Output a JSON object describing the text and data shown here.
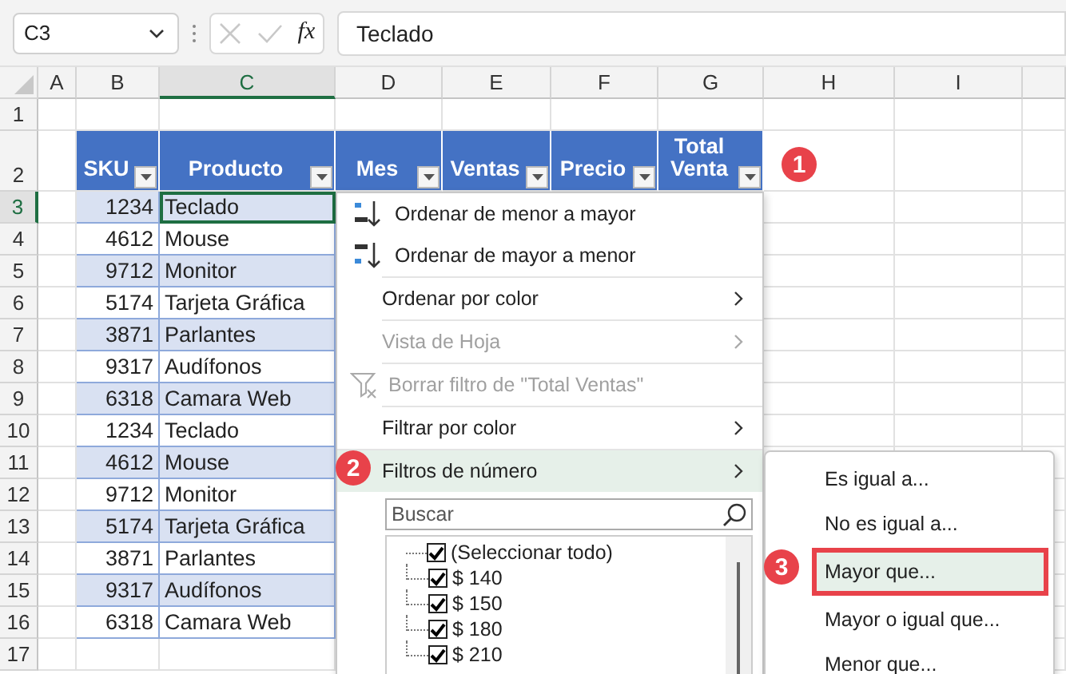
{
  "name_box": {
    "value": "C3"
  },
  "formula_bar": {
    "function_label": "fx",
    "value": "Teclado"
  },
  "columns": [
    {
      "label": "A",
      "selected": false
    },
    {
      "label": "B",
      "selected": false
    },
    {
      "label": "C",
      "selected": true
    },
    {
      "label": "D",
      "selected": false
    },
    {
      "label": "E",
      "selected": false
    },
    {
      "label": "F",
      "selected": false
    },
    {
      "label": "G",
      "selected": false
    },
    {
      "label": "H",
      "selected": false
    },
    {
      "label": "I",
      "selected": false
    }
  ],
  "rows": [
    {
      "label": "1",
      "selected": false
    },
    {
      "label": "2",
      "selected": false
    },
    {
      "label": "3",
      "selected": true
    },
    {
      "label": "4",
      "selected": false
    },
    {
      "label": "5",
      "selected": false
    },
    {
      "label": "6",
      "selected": false
    },
    {
      "label": "7",
      "selected": false
    },
    {
      "label": "8",
      "selected": false
    },
    {
      "label": "9",
      "selected": false
    },
    {
      "label": "10",
      "selected": false
    },
    {
      "label": "11",
      "selected": false
    },
    {
      "label": "12",
      "selected": false
    },
    {
      "label": "13",
      "selected": false
    },
    {
      "label": "14",
      "selected": false
    },
    {
      "label": "15",
      "selected": false
    },
    {
      "label": "16",
      "selected": false
    },
    {
      "label": "17",
      "selected": false
    }
  ],
  "table": {
    "headers": [
      {
        "label": "SKU"
      },
      {
        "label": "Producto"
      },
      {
        "label": "Mes"
      },
      {
        "label": "Ventas"
      },
      {
        "label": "Precio"
      },
      {
        "label": "Total Venta"
      }
    ],
    "rows": [
      {
        "cells": [
          "1234",
          "Teclado"
        ]
      },
      {
        "cells": [
          "4612",
          "Mouse"
        ]
      },
      {
        "cells": [
          "9712",
          "Monitor"
        ]
      },
      {
        "cells": [
          "5174",
          "Tarjeta Gráfica"
        ]
      },
      {
        "cells": [
          "3871",
          "Parlantes"
        ]
      },
      {
        "cells": [
          "9317",
          "Audífonos"
        ]
      },
      {
        "cells": [
          "6318",
          "Camara Web"
        ]
      },
      {
        "cells": [
          "1234",
          "Teclado"
        ]
      },
      {
        "cells": [
          "4612",
          "Mouse"
        ]
      },
      {
        "cells": [
          "9712",
          "Monitor"
        ]
      },
      {
        "cells": [
          "5174",
          "Tarjeta Gráfica"
        ]
      },
      {
        "cells": [
          "3871",
          "Parlantes"
        ]
      },
      {
        "cells": [
          "9317",
          "Audífonos"
        ]
      },
      {
        "cells": [
          "6318",
          "Camara Web"
        ]
      }
    ]
  },
  "filter_menu": {
    "items": [
      {
        "kind": "sort-asc",
        "label": "Ordenar de menor a mayor",
        "disabled": false,
        "selected": false
      },
      {
        "kind": "sort-desc",
        "label": "Ordenar de mayor a menor",
        "disabled": false,
        "selected": false
      },
      {
        "kind": "submenu",
        "label": "Ordenar por color",
        "disabled": false,
        "selected": false
      },
      {
        "kind": "submenu",
        "label": "Vista de Hoja",
        "disabled": true,
        "selected": false
      },
      {
        "kind": "clear-filter",
        "label": "Borrar filtro de \"Total Ventas\"",
        "disabled": true,
        "selected": false
      },
      {
        "kind": "submenu",
        "label": "Filtrar por color",
        "disabled": false,
        "selected": false
      },
      {
        "kind": "submenu",
        "label": "Filtros de número",
        "disabled": false,
        "selected": true
      }
    ],
    "search": {
      "placeholder": "Buscar"
    },
    "values": [
      {
        "label": "(Seleccionar todo)",
        "checked": true
      },
      {
        "label": "$ 140",
        "checked": true
      },
      {
        "label": "$ 150",
        "checked": true
      },
      {
        "label": "$ 180",
        "checked": true
      },
      {
        "label": "$ 210",
        "checked": true
      }
    ]
  },
  "number_filters_menu": {
    "items": [
      {
        "label": "Es igual a...",
        "selected": false
      },
      {
        "label": "No es igual a...",
        "selected": false
      },
      {
        "label": "Mayor que...",
        "selected": true
      },
      {
        "label": "Mayor o igual que...",
        "selected": false
      },
      {
        "label": "Menor que...",
        "selected": false
      }
    ]
  },
  "callouts": [
    {
      "label": "1"
    },
    {
      "label": "2"
    },
    {
      "label": "3"
    }
  ]
}
